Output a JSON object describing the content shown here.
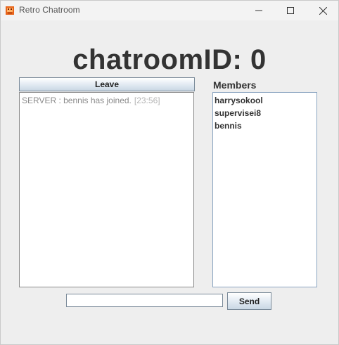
{
  "window": {
    "title": "Retro Chatroom"
  },
  "room": {
    "title": "chatroomID: 0"
  },
  "leave_button": {
    "label": "Leave"
  },
  "chat": {
    "messages": [
      {
        "text": "SERVER : bennis has joined.",
        "time": "[23:56]"
      }
    ]
  },
  "members": {
    "label": "Members",
    "items": [
      "harrysokool",
      "supervisei8",
      "bennis"
    ]
  },
  "composer": {
    "input_value": "",
    "send_label": "Send"
  },
  "colors": {
    "background": "#eeeeee",
    "app_icon": "#e8641a",
    "button_gradient_bottom": "#c9d7e4"
  }
}
